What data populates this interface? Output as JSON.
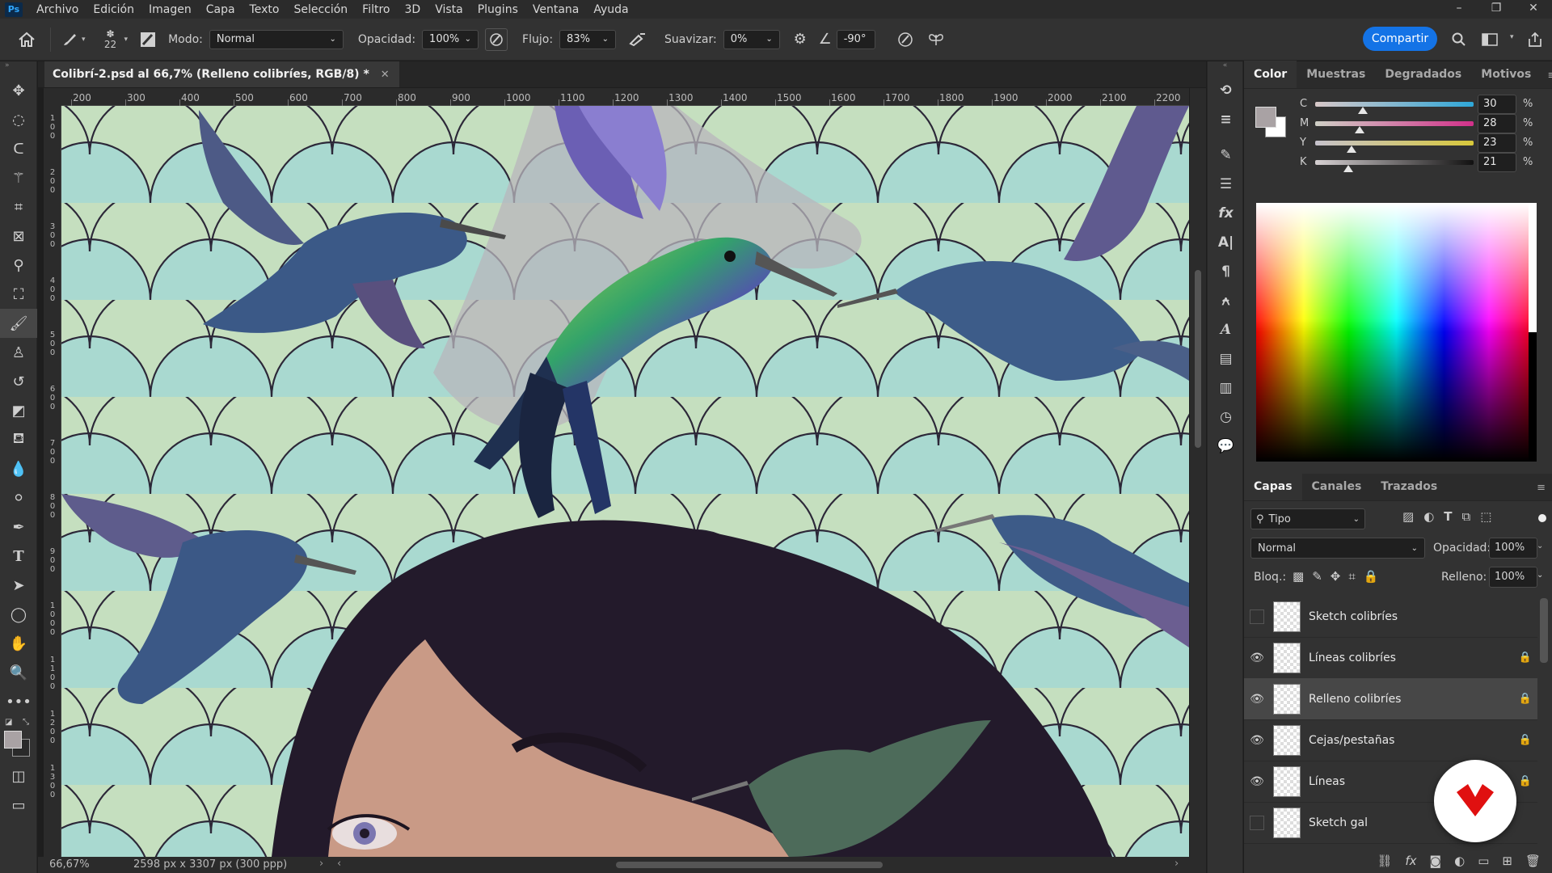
{
  "menubar": {
    "items": [
      "Archivo",
      "Edición",
      "Imagen",
      "Capa",
      "Texto",
      "Selección",
      "Filtro",
      "3D",
      "Vista",
      "Plugins",
      "Ventana",
      "Ayuda"
    ],
    "window_controls": [
      "–",
      "❐",
      "✕"
    ]
  },
  "options": {
    "brush_size": "22",
    "mode_label": "Modo:",
    "mode_value": "Normal",
    "opacity_label": "Opacidad:",
    "opacity_value": "100%",
    "flow_label": "Flujo:",
    "flow_value": "83%",
    "smooth_label": "Suavizar:",
    "smooth_value": "0%",
    "angle_value": "-90°",
    "share_label": "Compartir"
  },
  "document": {
    "tab_title": "Colibrí-2.psd al 66,7% (Relleno colibríes, RGB/8) *",
    "zoom": "66,67%",
    "dimensions": "2598 px x 3307 px (300 ppp)",
    "ruler_top": [
      "200",
      "300",
      "400",
      "500",
      "600",
      "700",
      "800",
      "900",
      "1000",
      "1100",
      "1200",
      "1300",
      "1400",
      "1500",
      "1600",
      "1700",
      "1800",
      "1900",
      "2000",
      "2100",
      "2200"
    ],
    "ruler_left": [
      "1 0 0",
      "2 0 0",
      "3 0 0",
      "4 0 0",
      "5 0 0",
      "6 0 0",
      "7 0 0",
      "8 0 0",
      "9 0 0",
      "1 0 0 0",
      "1 1 0 0",
      "1 2 0 0",
      "1 3 0 0"
    ]
  },
  "color_panel": {
    "tabs": [
      "Color",
      "Muestras",
      "Degradados",
      "Motivos"
    ],
    "active_tab": 0,
    "foreground": "#a9a2a4",
    "background": "#ffffff",
    "cmyk": [
      {
        "label": "C",
        "value": "30",
        "unit": "%",
        "fraction": 0.3
      },
      {
        "label": "M",
        "value": "28",
        "unit": "%",
        "fraction": 0.28
      },
      {
        "label": "Y",
        "value": "23",
        "unit": "%",
        "fraction": 0.23
      },
      {
        "label": "K",
        "value": "21",
        "unit": "%",
        "fraction": 0.21
      }
    ]
  },
  "layers_panel": {
    "tabs": [
      "Capas",
      "Canales",
      "Trazados"
    ],
    "active_tab": 0,
    "filter_placeholder": "Tipo",
    "blend_mode": "Normal",
    "opacity_label": "Opacidad:",
    "opacity_value": "100%",
    "lock_label": "Bloq.:",
    "fill_label": "Relleno:",
    "fill_value": "100%",
    "layers": [
      {
        "name": "Sketch colibríes",
        "visible": false,
        "locked": false,
        "selected": false
      },
      {
        "name": "Líneas colibríes",
        "visible": true,
        "locked": true,
        "selected": false
      },
      {
        "name": "Relleno colibríes",
        "visible": true,
        "locked": true,
        "selected": true
      },
      {
        "name": "Cejas/pestañas",
        "visible": true,
        "locked": true,
        "selected": false
      },
      {
        "name": "Líneas",
        "visible": true,
        "locked": true,
        "selected": false
      },
      {
        "name": "Sketch gal",
        "visible": false,
        "locked": false,
        "selected": false
      }
    ]
  },
  "colors": {
    "accent": "#1473e6",
    "canvas_green": "#c5dfbf",
    "canvas_teal": "#a8d8cf",
    "hair": "#231a2b",
    "skin": "#c99a86",
    "bird_blue": "#3d5d8a",
    "watermark_red": "#e01010"
  }
}
